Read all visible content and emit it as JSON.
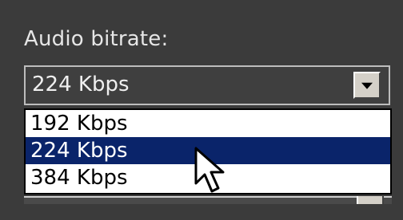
{
  "labels": {
    "audio_bitrate": "Audio bitrate:"
  },
  "combo": {
    "selected_value": "224 Kbps"
  },
  "dropdown": {
    "options": [
      {
        "label": "192 Kbps"
      },
      {
        "label": "224 Kbps",
        "selected": true
      },
      {
        "label": "384 Kbps"
      }
    ]
  },
  "icons": {
    "dropdown_arrow": "chevron-down-icon",
    "mouse_cursor": "mouse-pointer-icon"
  },
  "colors": {
    "selection_bg": "#0a246a",
    "panel_bg": "#3b3b3b"
  }
}
